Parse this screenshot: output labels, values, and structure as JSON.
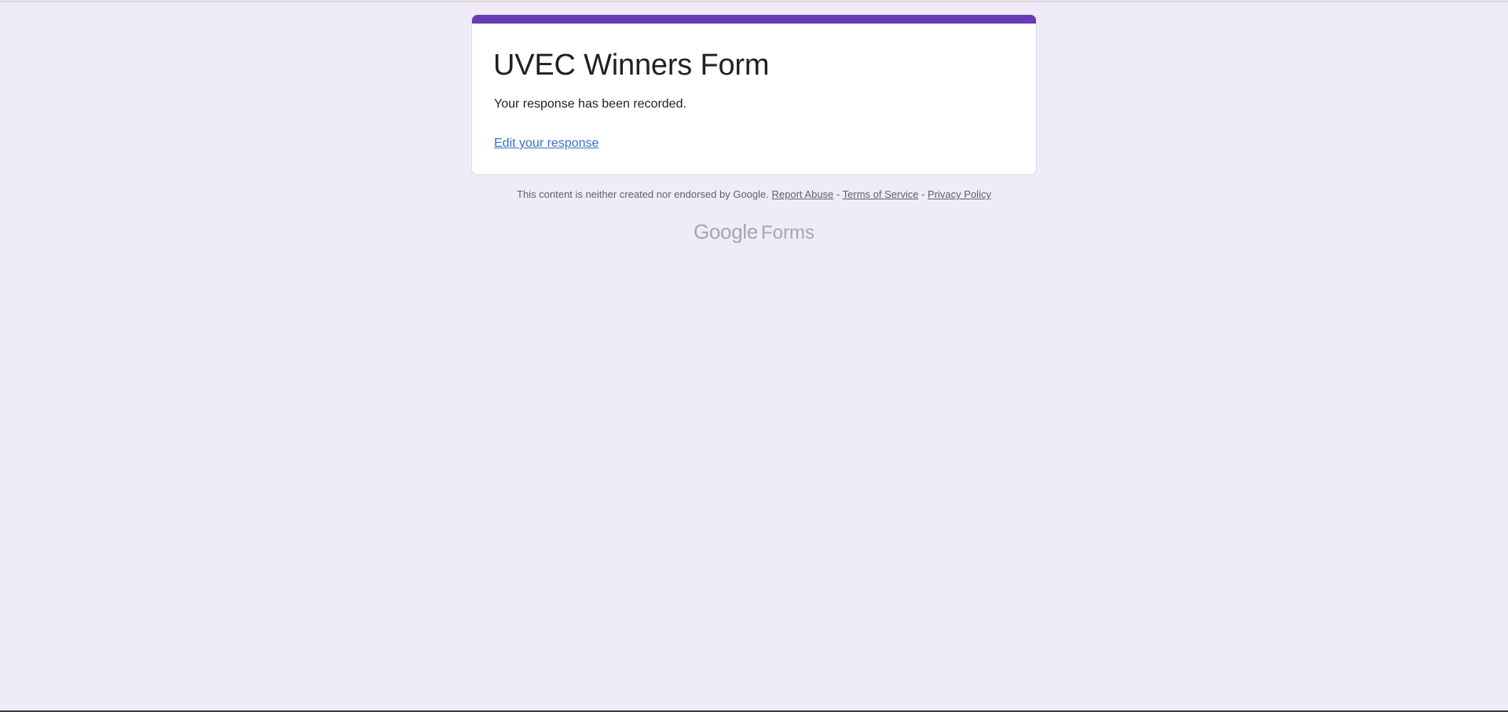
{
  "form": {
    "title": "UVEC Winners Form",
    "confirmation": "Your response has been recorded.",
    "edit_link": "Edit your response"
  },
  "footer": {
    "disclaimer": "This content is neither created nor endorsed by Google.",
    "report_abuse": "Report Abuse",
    "separator": "-",
    "terms": "Terms of Service",
    "privacy": "Privacy Policy"
  },
  "brand": {
    "google": "Google",
    "forms": "Forms"
  },
  "colors": {
    "background": "#f0ebf8",
    "accent": "#673ab7",
    "link": "#3a6fc7"
  }
}
